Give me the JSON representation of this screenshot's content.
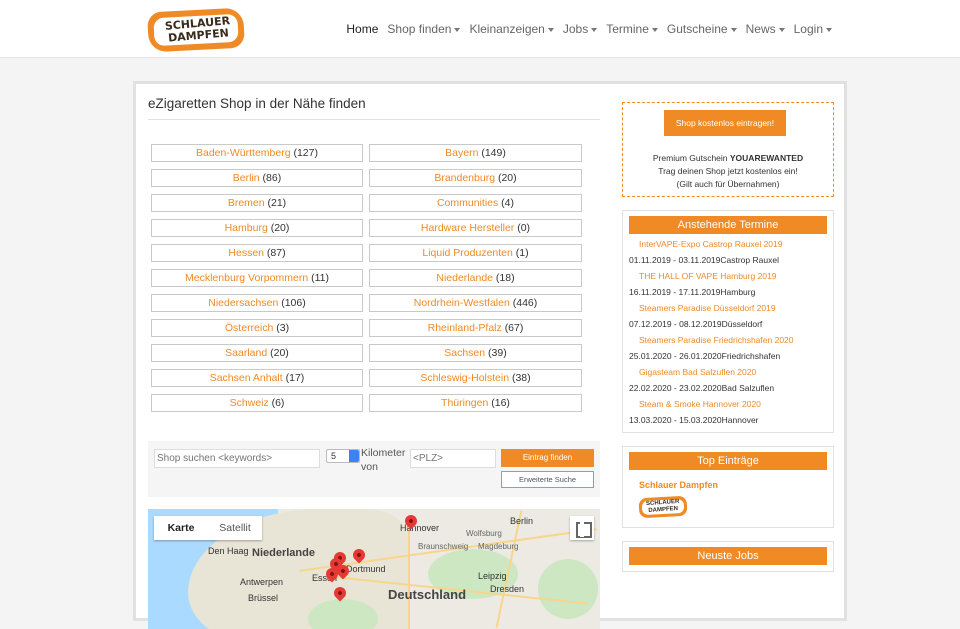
{
  "logo": {
    "line1": "SCHLAUER",
    "line2": "DAMPFEN"
  },
  "nav": [
    {
      "label": "Home",
      "dropdown": false,
      "active": true
    },
    {
      "label": "Shop finden",
      "dropdown": true
    },
    {
      "label": "Kleinanzeigen",
      "dropdown": true
    },
    {
      "label": "Jobs",
      "dropdown": true
    },
    {
      "label": "Termine",
      "dropdown": true
    },
    {
      "label": "Gutscheine",
      "dropdown": true
    },
    {
      "label": "News",
      "dropdown": true
    },
    {
      "label": "Login",
      "dropdown": true
    }
  ],
  "main": {
    "title": "eZigaretten Shop in der Nähe finden",
    "states": [
      {
        "name": "Baden-Württemberg",
        "count": "(127)"
      },
      {
        "name": "Bayern",
        "count": "(149)"
      },
      {
        "name": "Berlin",
        "count": "(86)"
      },
      {
        "name": "Brandenburg",
        "count": "(20)"
      },
      {
        "name": "Bremen",
        "count": "(21)"
      },
      {
        "name": "Communities",
        "count": "(4)"
      },
      {
        "name": "Hamburg",
        "count": "(20)"
      },
      {
        "name": "Hardware Hersteller",
        "count": "(0)"
      },
      {
        "name": "Hessen",
        "count": "(87)"
      },
      {
        "name": "Liquid Produzenten",
        "count": "(1)"
      },
      {
        "name": "Mecklenburg Vorpommern",
        "count": "(11)"
      },
      {
        "name": "Niederlande",
        "count": "(18)"
      },
      {
        "name": "Niedersachsen",
        "count": "(106)"
      },
      {
        "name": "Nordrhein-Westfalen",
        "count": "(446)"
      },
      {
        "name": "Österreich",
        "count": "(3)"
      },
      {
        "name": "Rheinland-Pfalz",
        "count": "(67)"
      },
      {
        "name": "Saarland",
        "count": "(20)"
      },
      {
        "name": "Sachsen",
        "count": "(39)"
      },
      {
        "name": "Sachsen Anhalt",
        "count": "(17)"
      },
      {
        "name": "Schleswig-Holstein",
        "count": "(38)"
      },
      {
        "name": "Schweiz",
        "count": "(6)"
      },
      {
        "name": "Thüringen",
        "count": "(16)"
      }
    ]
  },
  "search": {
    "keywords_placeholder": "Shop suchen <keywords>",
    "distance_value": "5",
    "km_label": "Kilometer von",
    "plz_placeholder": "<PLZ>",
    "find_button": "Eintrag finden",
    "advanced_button": "Erweiterte Suche"
  },
  "map": {
    "tab_map": "Karte",
    "tab_satellite": "Satellit",
    "labels": [
      "Hannover",
      "Berlin",
      "Wolfsburg",
      "Braunschweig",
      "Magdeburg",
      "Den Haag",
      "Niederlande",
      "Antwerpen",
      "Brüssel",
      "Dortmund",
      "Essen",
      "Leipzig",
      "Dresden",
      "Deutschland"
    ]
  },
  "sidebar": {
    "promo": {
      "button": "Shop kostenlos eintragen!",
      "line1_prefix": "Premium Gutschein ",
      "line1_code": "YOUAREWANTED",
      "line2": "Trag deinen Shop jetzt kostenlos ein!",
      "line3": "(Gilt auch für Übernahmen)"
    },
    "events_title": "Anstehende Termine",
    "events": [
      {
        "name": "InterVAPE-Expo Castrop Rauxel 2019",
        "dates": "01.11.2019 - 03.11.2019",
        "place": "Castrop Rauxel"
      },
      {
        "name": "THE HALL OF VAPE Hamburg 2019",
        "dates": "16.11.2019 - 17.11.2019",
        "place": "Hamburg"
      },
      {
        "name": "Steamers Paradise Düsseldorf 2019",
        "dates": "07.12.2019 - 08.12.2019",
        "place": "Düsseldorf"
      },
      {
        "name": "Steamers Paradise Friedrichshafen 2020",
        "dates": "25.01.2020 - 26.01.2020",
        "place": "Friedrichshafen"
      },
      {
        "name": "Gigasteam Bad Salzuflen 2020",
        "dates": "22.02.2020 - 23.02.2020",
        "place": "Bad Salzuflen"
      },
      {
        "name": "Steam & Smoke Hannover 2020",
        "dates": "13.03.2020 - 15.03.2020",
        "place": "Hannover"
      }
    ],
    "top_title": "Top Einträge",
    "top_entry": "Schlauer Dampfen",
    "jobs_title": "Neuste Jobs"
  },
  "colors": {
    "accent": "#f08a24",
    "pin": "#e53935"
  }
}
